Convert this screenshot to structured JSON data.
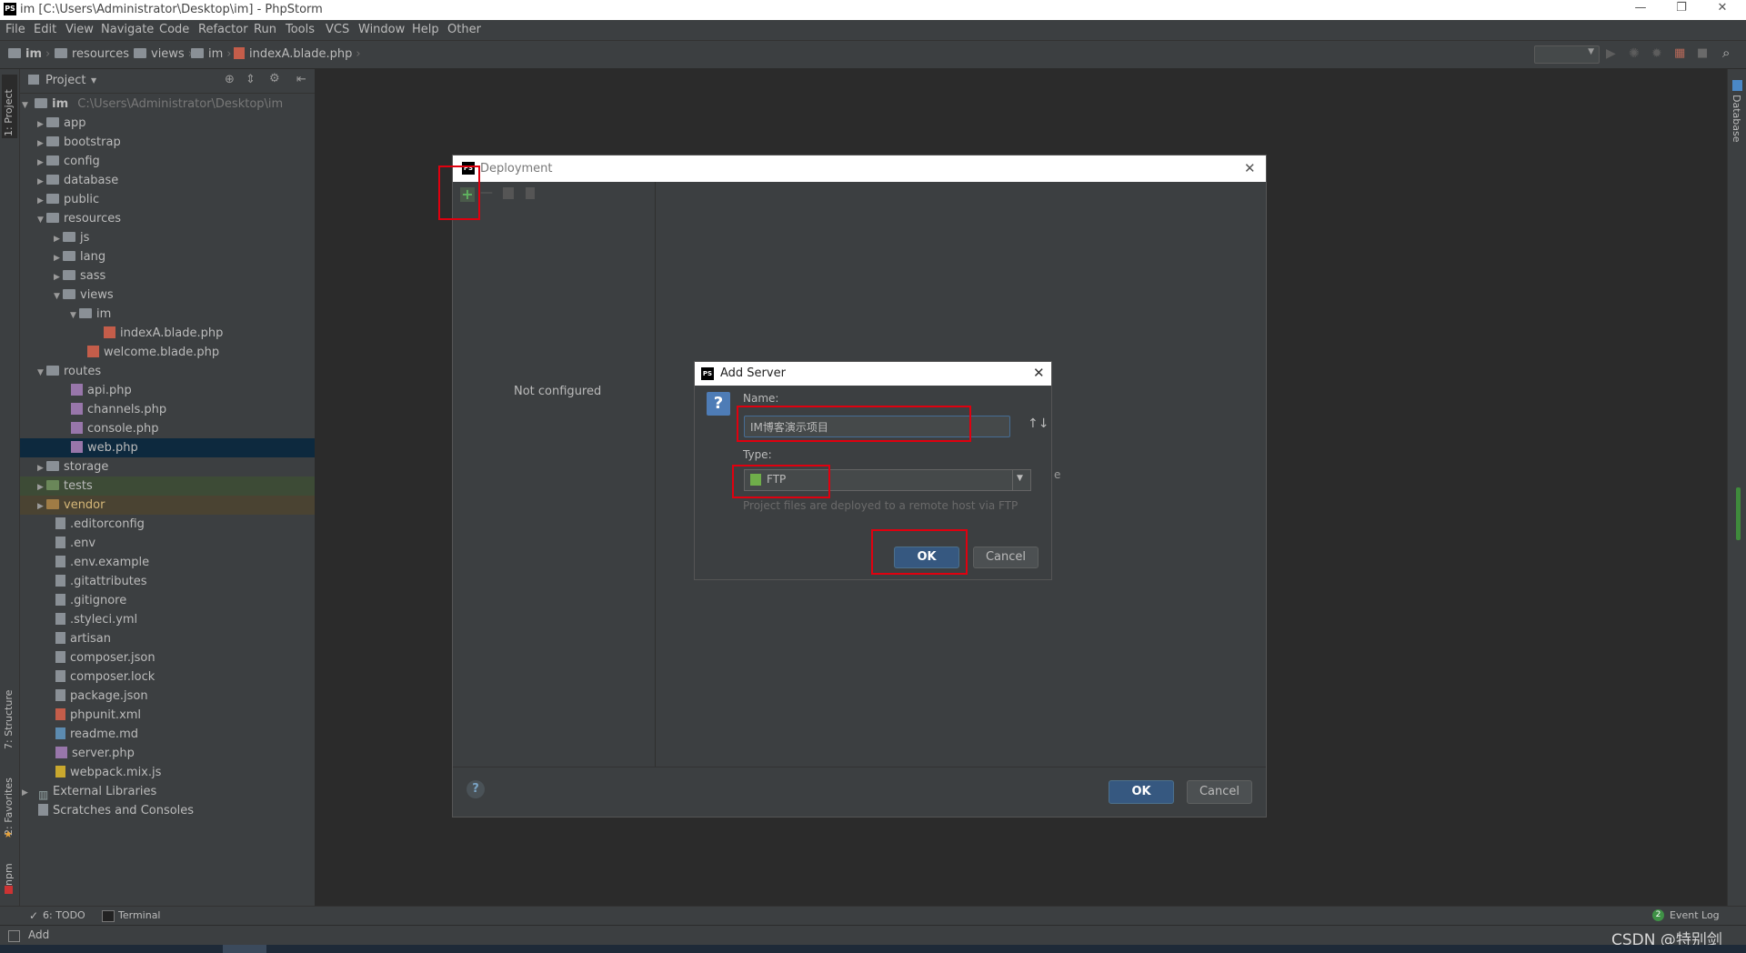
{
  "window": {
    "title": "im [C:\\Users\\Administrator\\Desktop\\im] - PhpStorm",
    "app_icon": "PS",
    "controls": [
      "minimize",
      "restore",
      "close"
    ]
  },
  "menu": [
    "File",
    "Edit",
    "View",
    "Navigate",
    "Code",
    "Refactor",
    "Run",
    "Tools",
    "VCS",
    "Window",
    "Help",
    "Other"
  ],
  "breadcrumb": [
    "im",
    "resources",
    "views",
    "im",
    "indexA.blade.php"
  ],
  "left_stripe": {
    "project": "1: Project",
    "structure": "7: Structure",
    "favorites": "2: Favorites",
    "npm": "npm"
  },
  "right_stripe": {
    "database": "Database"
  },
  "project_panel": {
    "title": "Project",
    "root_name": "im",
    "root_path": "C:\\Users\\Administrator\\Desktop\\im",
    "items": [
      {
        "label": "app"
      },
      {
        "label": "bootstrap"
      },
      {
        "label": "config"
      },
      {
        "label": "database"
      },
      {
        "label": "public"
      },
      {
        "label": "resources"
      },
      {
        "label": "js"
      },
      {
        "label": "lang"
      },
      {
        "label": "sass"
      },
      {
        "label": "views"
      },
      {
        "label": "im"
      },
      {
        "label": "indexA.blade.php"
      },
      {
        "label": "welcome.blade.php"
      },
      {
        "label": "routes"
      },
      {
        "label": "api.php"
      },
      {
        "label": "channels.php"
      },
      {
        "label": "console.php"
      },
      {
        "label": "web.php"
      },
      {
        "label": "storage"
      },
      {
        "label": "tests"
      },
      {
        "label": "vendor"
      },
      {
        "label": ".editorconfig"
      },
      {
        "label": ".env"
      },
      {
        "label": ".env.example"
      },
      {
        "label": ".gitattributes"
      },
      {
        "label": ".gitignore"
      },
      {
        "label": ".styleci.yml"
      },
      {
        "label": "artisan"
      },
      {
        "label": "composer.json"
      },
      {
        "label": "composer.lock"
      },
      {
        "label": "package.json"
      },
      {
        "label": "phpunit.xml"
      },
      {
        "label": "readme.md"
      },
      {
        "label": "server.php"
      },
      {
        "label": "webpack.mix.js"
      },
      {
        "label": "External Libraries"
      },
      {
        "label": "Scratches and Consoles"
      }
    ]
  },
  "deployment_dialog": {
    "title": "Deployment",
    "empty_text": "Not configured",
    "ok": "OK",
    "cancel": "Cancel",
    "clipped_char": "e"
  },
  "add_server_dialog": {
    "title": "Add Server",
    "name_label": "Name:",
    "name_value": "IM博客演示项目",
    "type_label": "Type:",
    "type_value": "FTP",
    "hint": "Project files are deployed to a remote host via FTP",
    "ok": "OK",
    "cancel": "Cancel"
  },
  "bottom_tools": {
    "todo": "6: TODO",
    "terminal": "Terminal",
    "event_log": "Event Log",
    "event_count": "2"
  },
  "status": {
    "text": "Add"
  },
  "watermark": "CSDN @特别剑",
  "colors": {
    "accent": "#365880",
    "highlight": "#e0000f",
    "selection": "#0d293e"
  }
}
